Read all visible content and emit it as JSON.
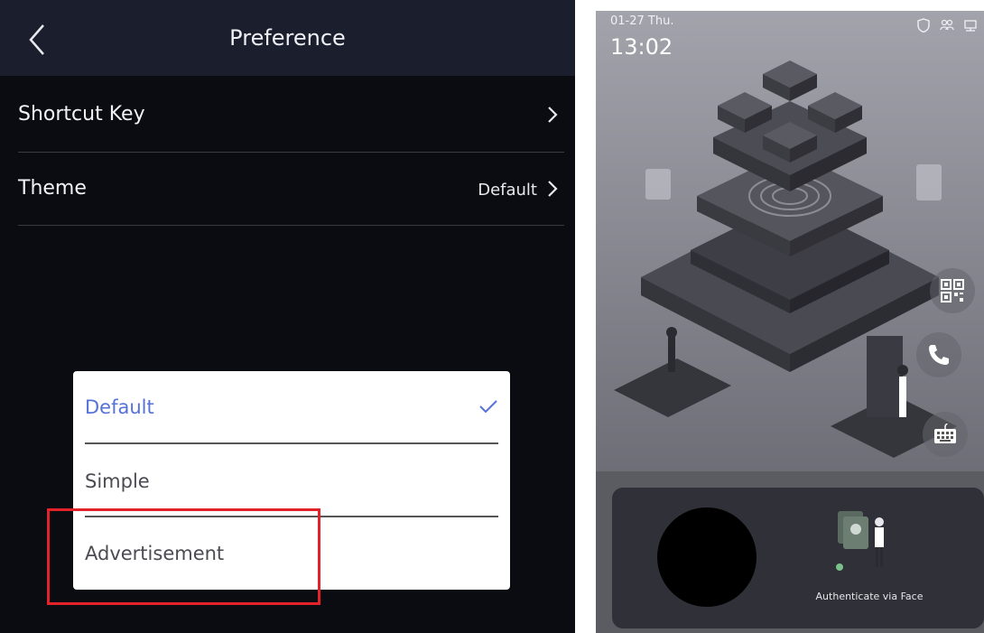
{
  "preference": {
    "title": "Preference",
    "rows": [
      {
        "label": "Shortcut Key",
        "value": ""
      },
      {
        "label": "Theme",
        "value": "Default"
      }
    ]
  },
  "theme_popup": {
    "options": [
      {
        "label": "Default",
        "selected": true
      },
      {
        "label": "Simple",
        "selected": false
      },
      {
        "label": "Advertisement",
        "selected": false
      }
    ],
    "highlighted": "Advertisement",
    "highlight_color": "#e2242a",
    "accent_color": "#5672d8"
  },
  "device": {
    "date": "01-27 Thu.",
    "time": "13:02",
    "status_icons": [
      "shield-icon",
      "user-group-icon",
      "network-icon"
    ],
    "shortcuts": [
      "qr-code-icon",
      "phone-icon",
      "keyboard-icon"
    ],
    "auth_text": "Authenticate via Face"
  }
}
